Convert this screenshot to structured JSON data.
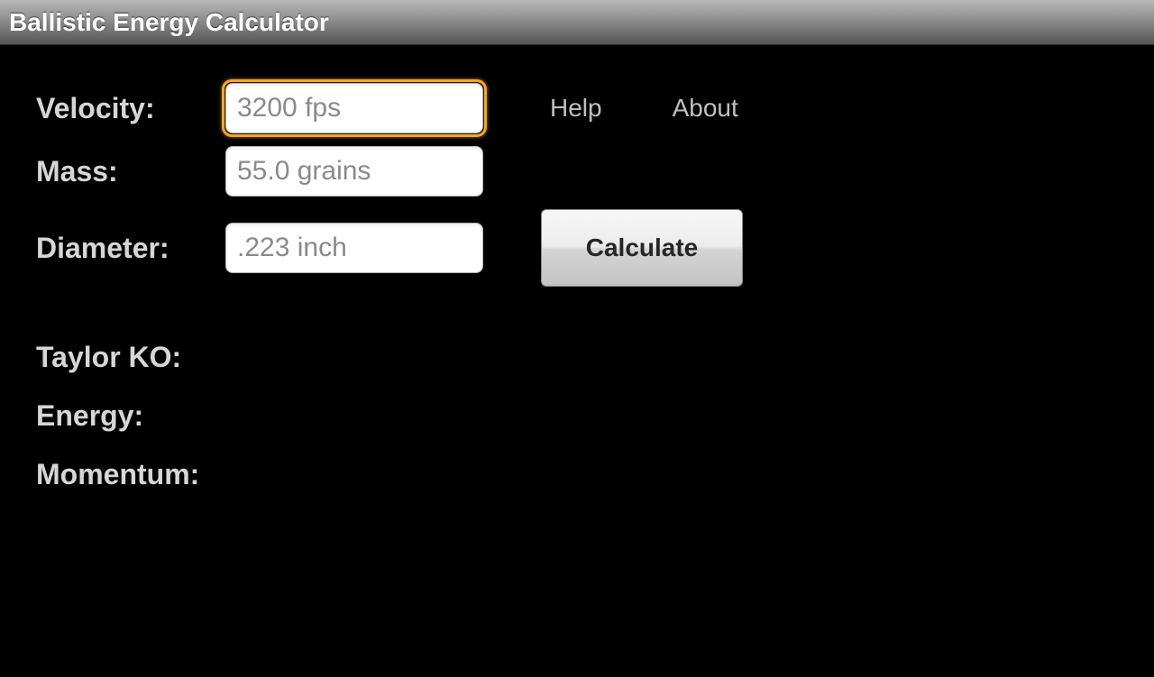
{
  "titleBar": {
    "title": "Ballistic Energy Calculator"
  },
  "inputs": {
    "velocity": {
      "label": "Velocity:",
      "placeholder": "3200 fps",
      "value": ""
    },
    "mass": {
      "label": "Mass:",
      "placeholder": "55.0 grains",
      "value": ""
    },
    "diameter": {
      "label": "Diameter:",
      "placeholder": ".223 inch",
      "value": ""
    }
  },
  "links": {
    "help": "Help",
    "about": "About"
  },
  "buttons": {
    "calculate": "Calculate"
  },
  "results": {
    "taylorKO": {
      "label": "Taylor KO:",
      "value": ""
    },
    "energy": {
      "label": "Energy:",
      "value": ""
    },
    "momentum": {
      "label": "Momentum:",
      "value": ""
    }
  }
}
